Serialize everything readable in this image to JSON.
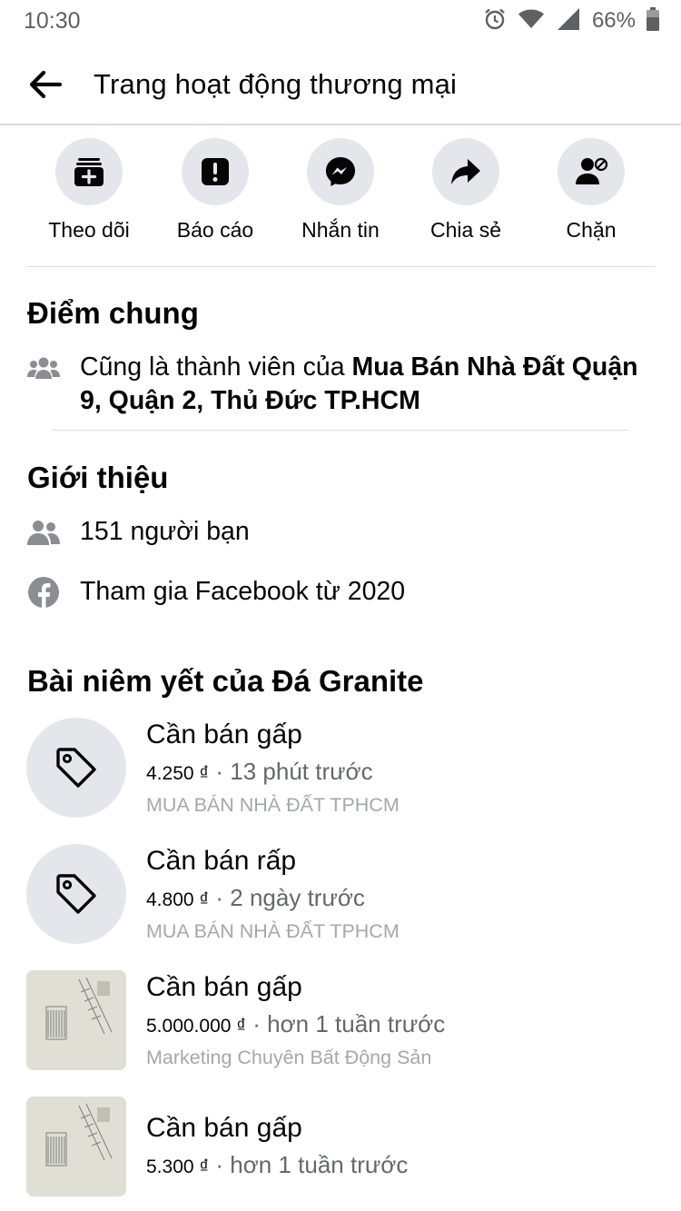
{
  "status_bar": {
    "time": "10:30",
    "battery_percent": "66%"
  },
  "header": {
    "title": "Trang hoạt động thương mại"
  },
  "actions": [
    {
      "label": "Theo dõi",
      "icon": "follow-icon"
    },
    {
      "label": "Báo cáo",
      "icon": "report-icon"
    },
    {
      "label": "Nhắn tin",
      "icon": "messenger-icon"
    },
    {
      "label": "Chia sẻ",
      "icon": "share-icon"
    },
    {
      "label": "Chặn",
      "icon": "block-user-icon"
    }
  ],
  "common": {
    "title": "Điểm chung",
    "member_prefix": "Cũng là thành viên của ",
    "member_group": "Mua Bán Nhà Đất Quận 9, Quận 2, Thủ Đức TP.HCM"
  },
  "intro": {
    "title": "Giới thiệu",
    "friends": "151 người bạn",
    "joined": "Tham gia Facebook từ 2020"
  },
  "listings_section": {
    "title": "Bài niêm yết của Đá Granite",
    "items": [
      {
        "title": "Cần bán gấp",
        "price": "4.250 ₫",
        "sep": " · ",
        "time": "13 phút trước",
        "group": "MUA BÁN NHÀ ĐẤT TPHCM",
        "thumb": "tag-icon"
      },
      {
        "title": "Cần bán rấp",
        "price": "4.800 ₫",
        "sep": " · ",
        "time": "2 ngày trước",
        "group": "MUA BÁN NHÀ ĐẤT TPHCM",
        "thumb": "tag-icon"
      },
      {
        "title": "Cần bán gấp",
        "price": "5.000.000 ₫",
        "sep": " · ",
        "time": "hơn 1 tuần trước",
        "group": "Marketing Chuyên Bất Động Sản",
        "thumb": "photo"
      },
      {
        "title": "Cần bán gấp",
        "price": "5.300 ₫",
        "sep": " · ",
        "time": "hơn 1 tuần trước",
        "group": "",
        "thumb": "photo"
      }
    ]
  }
}
